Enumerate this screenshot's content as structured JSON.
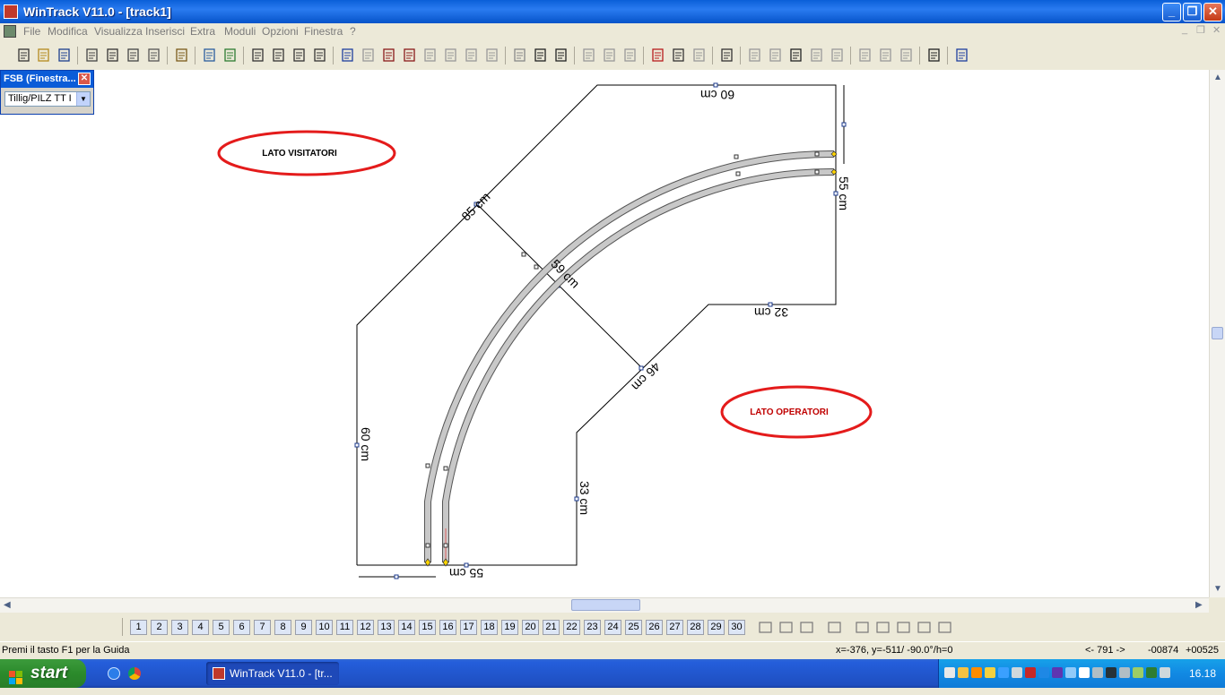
{
  "window": {
    "title": "WinTrack  V11.0 - [track1]"
  },
  "caption_buttons": {
    "minimize": "_",
    "restore": "❐",
    "close": "✕"
  },
  "menu": [
    "File",
    "Modifica",
    "Visualizza",
    "Inserisci",
    "Extra",
    "Moduli",
    "Opzioni",
    "Finestra",
    "?"
  ],
  "mdi_buttons": {
    "minimize": "_",
    "restore": "❐",
    "close": "✕"
  },
  "toolbar_icons": [
    "new-file-icon",
    "open-folder-icon",
    "save-icon",
    "print-preview-icon",
    "print-icon",
    "print-setup-icon",
    "page-icon",
    "layer-stack-icon",
    "sliders-icon",
    "picture-icon",
    "zoom-out-icon",
    "zoom-in-icon",
    "zoom-window-icon",
    "zoom-fit-icon",
    "undo-icon",
    "redo-icon",
    "list-icon",
    "properties-icon",
    "blank-doc-icon",
    "cut-icon",
    "copy-icon",
    "paste-icon",
    "track-select-icon",
    "straight-track-icon",
    "curve-track-icon",
    "grid-icon",
    "stack-icon",
    "stack2-icon",
    "move-cross-icon",
    "rotate-select-icon",
    "rotate-180-icon",
    "measure-icon",
    "switch-left-icon",
    "switch-right-icon",
    "crossing-icon",
    "branch-icon",
    "parallel-icon",
    "ruler-icon",
    "ruler2-icon",
    "ruler3-icon",
    "snowflake-icon",
    "help-arrow-icon"
  ],
  "fsb": {
    "title": "FSB (Finestra...",
    "selected": "Tillig/PILZ  TT I",
    "close": "✕"
  },
  "drawing": {
    "dims": {
      "top": "60 cm",
      "right": "55 cm",
      "diag": "85 cm",
      "radius": "59 cm",
      "inner_top": "32 cm",
      "inner_diag": "46 cm",
      "left": "60 cm",
      "inner_bottom": "33 cm",
      "bottom": "55 cm"
    },
    "labels": {
      "visitors": "LATO VISITATORI",
      "operators": "LATO OPERATORI"
    },
    "colors": {
      "ellipse": "#e41b1b",
      "track_fill": "#c8c8c8",
      "line": "#000000"
    }
  },
  "layers": [
    "1",
    "2",
    "3",
    "4",
    "5",
    "6",
    "7",
    "8",
    "9",
    "10",
    "11",
    "12",
    "13",
    "14",
    "15",
    "16",
    "17",
    "18",
    "19",
    "20",
    "21",
    "22",
    "23",
    "24",
    "25",
    "26",
    "27",
    "28",
    "29",
    "30"
  ],
  "status": {
    "help": "Premi il tasto F1 per la Guida",
    "coords": "x=-376, y=-511/ -90.0°/h=0",
    "count": "<- 791 ->",
    "v1": "-00874",
    "v2": "+00525"
  },
  "taskbar": {
    "start": "start",
    "task": "WinTrack  V11.0 - [tr...",
    "clock": "16.18"
  }
}
